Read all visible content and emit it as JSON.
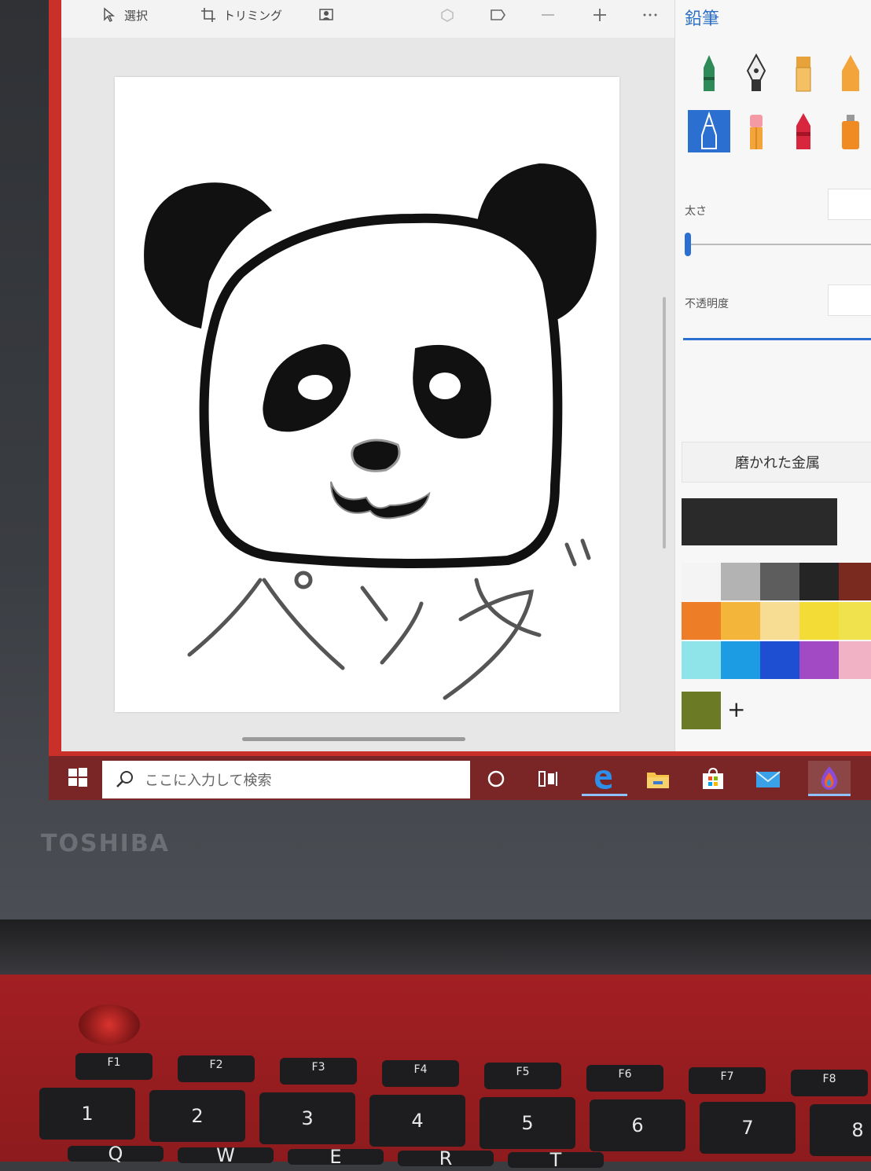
{
  "toolbar": {
    "select_label": "選択",
    "crop_label": "トリミング"
  },
  "side_panel": {
    "title": "鉛筆",
    "thickness_label": "太さ",
    "opacity_label": "不透明度",
    "texture_label": "磨かれた金属",
    "current_color": "#2a2a2a",
    "palette": [
      "#f4f4f4",
      "#b3b3b3",
      "#5d5d5d",
      "#252525",
      "#7a2a1e",
      "#ee7d28",
      "#f3b63a",
      "#f7dc93",
      "#f2dc35",
      "#efe24d",
      "#8fe4e9",
      "#1c9ce3",
      "#1e4fd3",
      "#a249c4",
      "#f2b2c6",
      "#6b7a25"
    ],
    "add_color_label": "+"
  },
  "drawing": {
    "caption": "パンダ"
  },
  "taskbar": {
    "search_placeholder": "ここに入力して検索"
  },
  "laptop": {
    "brand": "TOSHIBA"
  },
  "keyboard": {
    "function_keys": [
      "F1",
      "F2",
      "F3",
      "F4",
      "F5",
      "F6",
      "F7",
      "F8"
    ],
    "number_keys": [
      "1",
      "2",
      "3",
      "4",
      "5",
      "6",
      "7",
      "8"
    ],
    "letter_keys": [
      "Q",
      "W",
      "E",
      "R",
      "T"
    ]
  }
}
